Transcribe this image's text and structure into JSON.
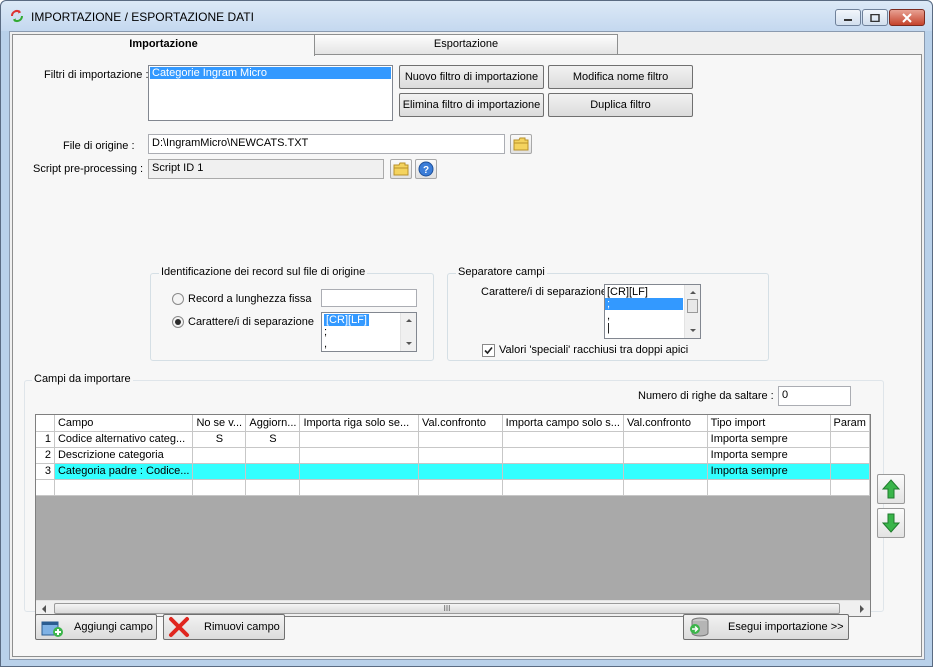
{
  "window": {
    "title": "IMPORTAZIONE / ESPORTAZIONE DATI"
  },
  "tabs": [
    {
      "label": "Importazione",
      "active": true
    },
    {
      "label": "Esportazione",
      "active": false
    }
  ],
  "filters": {
    "label": "Filtri di importazione :",
    "items": [
      "Categorie Ingram Micro"
    ],
    "selected": "Categorie Ingram Micro",
    "buttons": {
      "new": "Nuovo filtro di importazione",
      "rename": "Modifica nome filtro",
      "delete": "Elimina filtro di importazione",
      "duplicate": "Duplica filtro"
    }
  },
  "source_file": {
    "label": "File di origine :",
    "value": "D:\\IngramMicro\\NEWCATS.TXT"
  },
  "script": {
    "label": "Script pre-processing :",
    "value": "Script ID 1"
  },
  "record_ident": {
    "title": "Identificazione dei record sul file di origine",
    "fixed_label": "Record a lunghezza fissa",
    "fixed_value": "",
    "sep_label": "Carattere/i di separazione",
    "selected_option": "separator",
    "sep_options": [
      "[CR][LF]",
      ";",
      ","
    ]
  },
  "field_sep": {
    "title": "Separatore campi",
    "label": "Carattere/i di separazione",
    "options": [
      "[CR][LF]",
      ";",
      ",",
      "|"
    ],
    "selected": ";",
    "quotes_label": "Valori 'speciali' racchiusi tra doppi apici",
    "quotes_checked": true
  },
  "fields": {
    "title": "Campi da importare",
    "skip_label": "Numero di righe da saltare :",
    "skip_value": "0",
    "columns": [
      "Campo",
      "No se v...",
      "Aggiorn...",
      "Importa riga solo se...",
      "Val.confronto",
      "Importa campo solo s...",
      "Val.confronto",
      "Tipo import",
      "Param"
    ],
    "rows": [
      {
        "num": "1",
        "cells": [
          "Codice alternativo categ...",
          "S",
          "S",
          "",
          "",
          "",
          "",
          "Importa sempre",
          ""
        ]
      },
      {
        "num": "2",
        "cells": [
          "Descrizione categoria",
          "",
          "",
          "",
          "",
          "",
          "",
          "Importa sempre",
          ""
        ]
      },
      {
        "num": "3",
        "cells": [
          "Categoria padre : Codice...",
          "",
          "",
          "",
          "",
          "",
          "",
          "Importa sempre",
          ""
        ],
        "highlight": true
      }
    ],
    "scroll_grip": "III"
  },
  "footer": {
    "add": "Aggiungi campo",
    "remove": "Rimuovi campo",
    "run": "Esegui importazione >>"
  },
  "colors": {
    "accent": "#3399ff",
    "highlight_row": "#33ffff",
    "window_frame": "#b9d1ea"
  }
}
